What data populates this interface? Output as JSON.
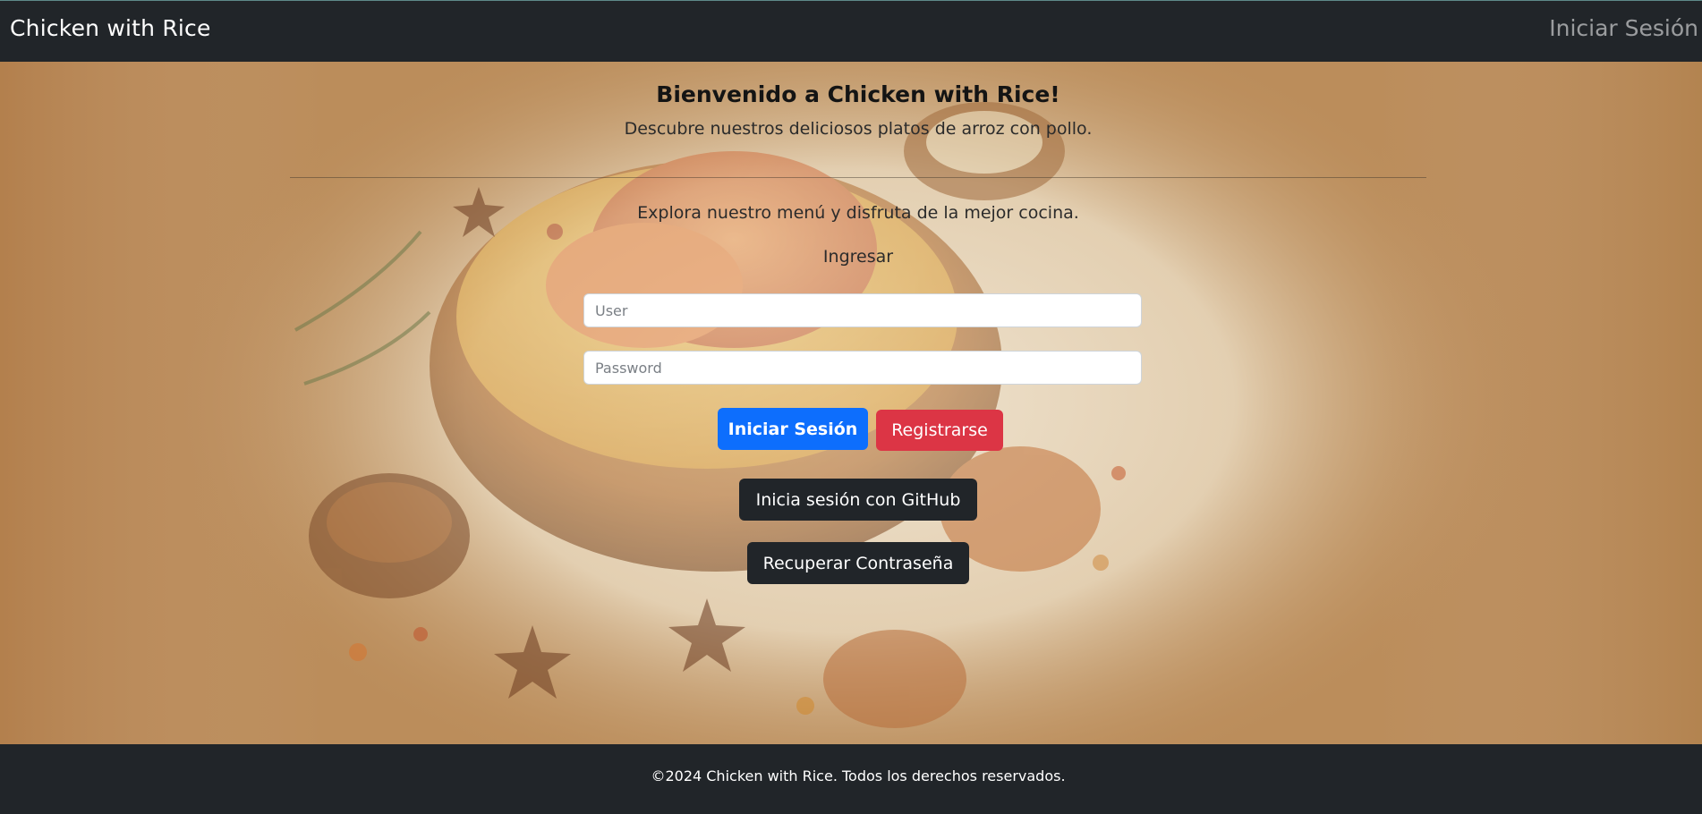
{
  "navbar": {
    "brand": "Chicken with Rice",
    "login_link": "Iniciar Sesión"
  },
  "hero": {
    "background_image": "chicken-rice-bowl-illustration",
    "title": "Bienvenido a Chicken with Rice!",
    "subtitle": "Descubre nuestros deliciosos platos de arroz con pollo.",
    "explore_text": "Explora nuestro menú y disfruta de la mejor cocina."
  },
  "login_form": {
    "heading": "Ingresar",
    "user_placeholder": "User",
    "user_value": "",
    "password_placeholder": "Password",
    "password_value": "",
    "login_button": "Iniciar Sesión",
    "register_button": "Registrarse",
    "github_button": "Inicia sesión con GitHub",
    "recover_button": "Recuperar Contraseña"
  },
  "footer": {
    "text": "©2024 Chicken with Rice. Todos los derechos reservados."
  },
  "colors": {
    "navbar_bg": "#212529",
    "primary": "#0d6efd",
    "danger": "#dc3545",
    "dark_button": "#212529",
    "background_tan": "#b98a57"
  }
}
